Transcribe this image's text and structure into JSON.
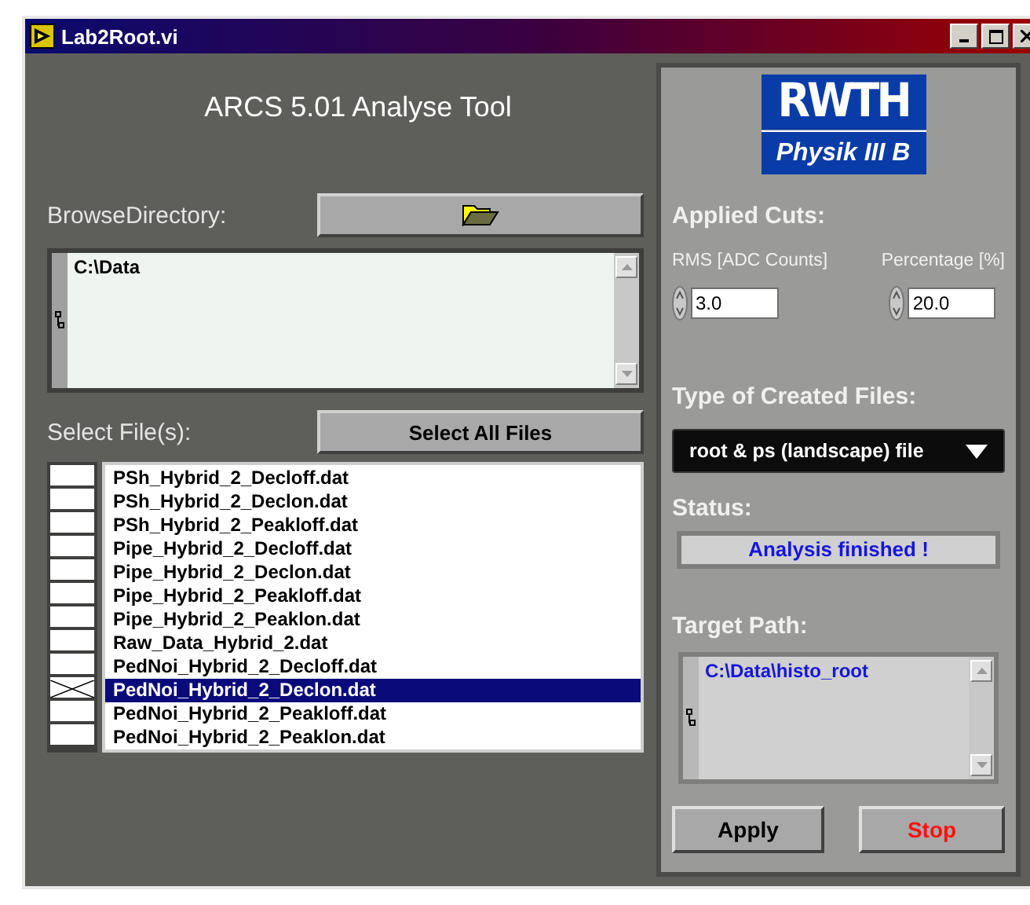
{
  "window": {
    "title": "Lab2Root.vi"
  },
  "heading": "ARCS 5.01 Analyse Tool",
  "browse": {
    "label": "BrowseDirectory:"
  },
  "directory": {
    "value": "C:\\Data"
  },
  "select_files": {
    "label": "Select File(s):",
    "button": "Select All Files"
  },
  "files": [
    {
      "name": "PSh_Hybrid_2_Decloff.dat",
      "checked": false,
      "selected": false
    },
    {
      "name": "PSh_Hybrid_2_Declon.dat",
      "checked": false,
      "selected": false
    },
    {
      "name": "PSh_Hybrid_2_Peakloff.dat",
      "checked": false,
      "selected": false
    },
    {
      "name": "Pipe_Hybrid_2_Decloff.dat",
      "checked": false,
      "selected": false
    },
    {
      "name": "Pipe_Hybrid_2_Declon.dat",
      "checked": false,
      "selected": false
    },
    {
      "name": "Pipe_Hybrid_2_Peakloff.dat",
      "checked": false,
      "selected": false
    },
    {
      "name": "Pipe_Hybrid_2_Peaklon.dat",
      "checked": false,
      "selected": false
    },
    {
      "name": "Raw_Data_Hybrid_2.dat",
      "checked": false,
      "selected": false
    },
    {
      "name": "PedNoi_Hybrid_2_Decloff.dat",
      "checked": false,
      "selected": false
    },
    {
      "name": "PedNoi_Hybrid_2_Declon.dat",
      "checked": true,
      "selected": true
    },
    {
      "name": "PedNoi_Hybrid_2_Peakloff.dat",
      "checked": false,
      "selected": false
    },
    {
      "name": "PedNoi_Hybrid_2_Peaklon.dat",
      "checked": false,
      "selected": false
    }
  ],
  "logo": {
    "top": "RWTH",
    "bottom": "Physik III B"
  },
  "cuts": {
    "label": "Applied Cuts:",
    "rms": {
      "label": "RMS [ADC Counts]",
      "value": "3.0"
    },
    "percentage": {
      "label": "Percentage [%]",
      "value": "20.0"
    }
  },
  "file_type": {
    "label": "Type of Created Files:",
    "value": "root & ps (landscape) file"
  },
  "status": {
    "label": "Status:",
    "value": "Analysis finished !"
  },
  "target_path": {
    "label": "Target Path:",
    "value": "C:\\Data\\histo_root"
  },
  "buttons": [
    {
      "label": "Apply",
      "kind": "apply"
    },
    {
      "label": "Stop",
      "kind": "stop"
    }
  ]
}
